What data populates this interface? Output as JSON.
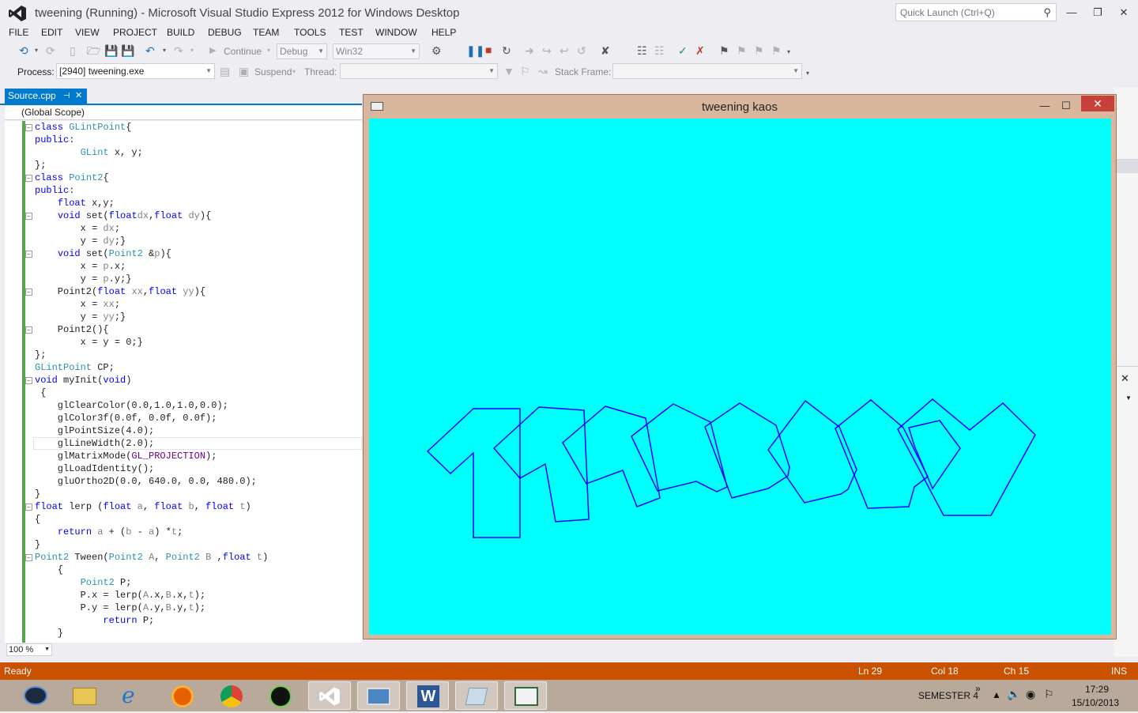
{
  "window": {
    "title": "tweening (Running) - Microsoft Visual Studio Express 2012 for Windows Desktop",
    "quick_launch_placeholder": "Quick Launch (Ctrl+Q)",
    "minimize": "—",
    "restore": "❐",
    "close": "✕"
  },
  "menu": [
    "FILE",
    "EDIT",
    "VIEW",
    "PROJECT",
    "BUILD",
    "DEBUG",
    "TEAM",
    "TOOLS",
    "TEST",
    "WINDOW",
    "HELP"
  ],
  "toolbar": {
    "continue_label": "Continue",
    "config": "Debug",
    "platform": "Win32",
    "process_label": "Process:",
    "process_value": "[2940] tweening.exe",
    "suspend_label": "Suspend",
    "thread_label": "Thread:",
    "stack_frame_label": "Stack Frame:"
  },
  "editor": {
    "tab_label": "Source.cpp",
    "tab_pin": "⊣",
    "tab_close": "✕",
    "scope": "(Global Scope)",
    "zoom": "100 %"
  },
  "code_lines": [
    [
      [
        "kw",
        "class "
      ],
      [
        "ty",
        "GLintPoint"
      ],
      [
        "",
        "{"
      ]
    ],
    [
      [
        "kw",
        "public"
      ],
      [
        "",
        ":"
      ]
    ],
    [
      [
        "",
        "        "
      ],
      [
        "ty",
        "GLint"
      ],
      [
        "",
        " x, y;"
      ]
    ],
    [
      [
        "",
        "};"
      ]
    ],
    [
      [
        "kw",
        "class "
      ],
      [
        "ty",
        "Point2"
      ],
      [
        "",
        "{"
      ]
    ],
    [
      [
        "kw",
        "public"
      ],
      [
        "",
        ":"
      ]
    ],
    [
      [
        "",
        "    "
      ],
      [
        "kw",
        "float"
      ],
      [
        "",
        " x,y;"
      ]
    ],
    [
      [
        "",
        "    "
      ],
      [
        "kw",
        "void"
      ],
      [
        "",
        " set("
      ],
      [
        "kw",
        "float"
      ],
      [
        " ",
        ""
      ],
      [
        "pa",
        "dx"
      ],
      [
        "",
        ","
      ],
      [
        "kw",
        "float"
      ],
      [
        "",
        " "
      ],
      [
        "pa",
        "dy"
      ],
      [
        "",
        "){"
      ]
    ],
    [
      [
        "",
        "        x = "
      ],
      [
        "pa",
        "dx"
      ],
      [
        "",
        ";"
      ]
    ],
    [
      [
        "",
        "        y = "
      ],
      [
        "pa",
        "dy"
      ],
      [
        "",
        ";}"
      ]
    ],
    [
      [
        "",
        "    "
      ],
      [
        "kw",
        "void"
      ],
      [
        "",
        " set("
      ],
      [
        "ty",
        "Point2"
      ],
      [
        "",
        " &"
      ],
      [
        "pa",
        "p"
      ],
      [
        "",
        "){"
      ]
    ],
    [
      [
        "",
        "        x = "
      ],
      [
        "pa",
        "p"
      ],
      [
        "",
        ".x;"
      ]
    ],
    [
      [
        "",
        "        y = "
      ],
      [
        "pa",
        "p"
      ],
      [
        "",
        ".y;}"
      ]
    ],
    [
      [
        "",
        "    Point2("
      ],
      [
        "kw",
        "float"
      ],
      [
        "",
        " "
      ],
      [
        "pa",
        "xx"
      ],
      [
        "",
        ","
      ],
      [
        "kw",
        "float"
      ],
      [
        "",
        " "
      ],
      [
        "pa",
        "yy"
      ],
      [
        "",
        "){"
      ]
    ],
    [
      [
        "",
        "        x = "
      ],
      [
        "pa",
        "xx"
      ],
      [
        "",
        ";"
      ]
    ],
    [
      [
        "",
        "        y = "
      ],
      [
        "pa",
        "yy"
      ],
      [
        "",
        ";}"
      ]
    ],
    [
      [
        "",
        "    Point2(){"
      ]
    ],
    [
      [
        "",
        "        x = y = 0;}"
      ]
    ],
    [
      [
        "",
        "};"
      ]
    ],
    [
      [
        "ty",
        "GLintPoint"
      ],
      [
        "",
        " CP;"
      ]
    ],
    [
      [
        "kw",
        "void"
      ],
      [
        "",
        " myInit("
      ],
      [
        "kw",
        "void"
      ],
      [
        "",
        ")"
      ]
    ],
    [
      [
        "",
        " {"
      ]
    ],
    [
      [
        "",
        "    glClearColor(0.0,1.0,1.0,0.0);"
      ]
    ],
    [
      [
        "",
        "    glColor3f(0.0f, 0.0f, 0.0f);"
      ]
    ],
    [
      [
        "",
        "    glPointSize(4.0);"
      ]
    ],
    [
      [
        "",
        "    glLineWidth(2.0);"
      ]
    ],
    [
      [
        "",
        "    glMatrixMode("
      ],
      [
        "mc",
        "GL_PROJECTION"
      ],
      [
        "",
        ");"
      ]
    ],
    [
      [
        "",
        "    glLoadIdentity();"
      ]
    ],
    [
      [
        "",
        "    gluOrtho2D(0.0, 640.0, 0.0, 480.0);"
      ]
    ],
    [
      [
        "",
        "}"
      ]
    ],
    [
      [
        "kw",
        "float"
      ],
      [
        "",
        " lerp ("
      ],
      [
        "kw",
        "float"
      ],
      [
        "",
        " "
      ],
      [
        "pa",
        "a"
      ],
      [
        "",
        ", "
      ],
      [
        "kw",
        "float"
      ],
      [
        "",
        " "
      ],
      [
        "pa",
        "b"
      ],
      [
        "",
        ", "
      ],
      [
        "kw",
        "float"
      ],
      [
        "",
        " "
      ],
      [
        "pa",
        "t"
      ],
      [
        "",
        ")"
      ]
    ],
    [
      [
        "",
        "{"
      ]
    ],
    [
      [
        "",
        "    "
      ],
      [
        "kw",
        "return"
      ],
      [
        "",
        " "
      ],
      [
        "pa",
        "a"
      ],
      [
        "",
        " + ("
      ],
      [
        "pa",
        "b"
      ],
      [
        "",
        " - "
      ],
      [
        "pa",
        "a"
      ],
      [
        "",
        ") *"
      ],
      [
        "pa",
        "t"
      ],
      [
        "",
        ";"
      ]
    ],
    [
      [
        "",
        "}"
      ]
    ],
    [
      [
        "ty",
        "Point2"
      ],
      [
        "",
        " Tween("
      ],
      [
        "ty",
        "Point2"
      ],
      [
        "",
        " "
      ],
      [
        "pa",
        "A"
      ],
      [
        "",
        ", "
      ],
      [
        "ty",
        "Point2"
      ],
      [
        "",
        " "
      ],
      [
        "pa",
        "B"
      ],
      [
        "",
        " ,"
      ],
      [
        "kw",
        "float"
      ],
      [
        "",
        " "
      ],
      [
        "pa",
        "t"
      ],
      [
        "",
        ")"
      ]
    ],
    [
      [
        "",
        "    {"
      ]
    ],
    [
      [
        "",
        "        "
      ],
      [
        "ty",
        "Point2"
      ],
      [
        "",
        " P;"
      ]
    ],
    [
      [
        "",
        "        P.x = lerp("
      ],
      [
        "pa",
        "A"
      ],
      [
        "",
        ".x,"
      ],
      [
        "pa",
        "B"
      ],
      [
        "",
        ".x,"
      ],
      [
        "pa",
        "t"
      ],
      [
        "",
        ");"
      ]
    ],
    [
      [
        "",
        "        P.y = lerp("
      ],
      [
        "pa",
        "A"
      ],
      [
        "",
        ".y,"
      ],
      [
        "pa",
        "B"
      ],
      [
        "",
        ".y,"
      ],
      [
        "pa",
        "t"
      ],
      [
        "",
        ");"
      ]
    ],
    [
      [
        "",
        "            "
      ],
      [
        "kw",
        "return"
      ],
      [
        "",
        " P;"
      ]
    ],
    [
      [
        "",
        "    }"
      ]
    ]
  ],
  "gl_window": {
    "title": "tweening kaos",
    "minimize": "—",
    "maximize": "☐",
    "close": "✕",
    "background": "#00ffff",
    "stroke": "#0000ff"
  },
  "status": {
    "ready": "Ready",
    "ln": "Ln 29",
    "col": "Col 18",
    "ch": "Ch 15",
    "ins": "INS",
    "color": "#ca5100"
  },
  "taskbar": {
    "semester": "SEMESTER 4",
    "chevron": "»",
    "time": "17:29",
    "date": "15/10/2013"
  }
}
